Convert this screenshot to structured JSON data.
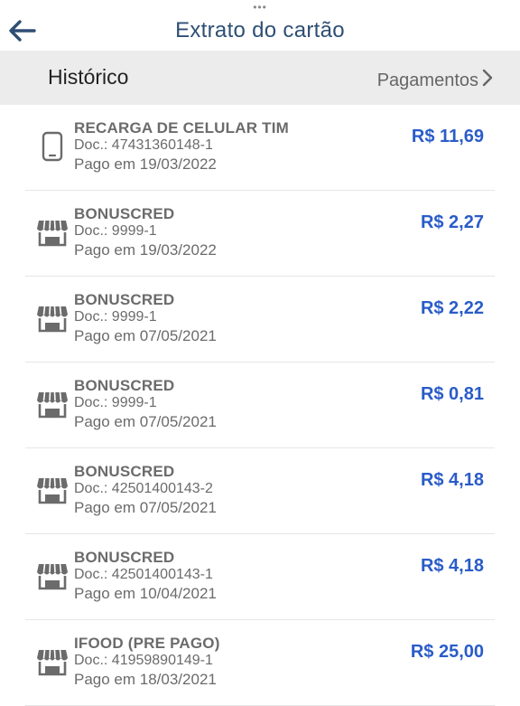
{
  "header": {
    "grabber": "•••",
    "title": "Extrato do cartão",
    "back_icon": "arrow-left-icon",
    "accent_color": "#2e4f73"
  },
  "subbar": {
    "left_label": "Histórico",
    "right_label": "Pagamentos",
    "right_icon": "chevron-right-icon"
  },
  "transactions": [
    {
      "icon": "phone-icon",
      "name": "RECARGA DE CELULAR TIM",
      "doc": "Doc.: 47431360148-1",
      "date": "Pago em 19/03/2022",
      "amount": "R$ 11,69"
    },
    {
      "icon": "store-icon",
      "name": "BONUSCRED",
      "doc": "Doc.: 9999-1",
      "date": "Pago em 19/03/2022",
      "amount": "R$ 2,27"
    },
    {
      "icon": "store-icon",
      "name": "BONUSCRED",
      "doc": "Doc.: 9999-1",
      "date": "Pago em 07/05/2021",
      "amount": "R$ 2,22"
    },
    {
      "icon": "store-icon",
      "name": "BONUSCRED",
      "doc": "Doc.: 9999-1",
      "date": "Pago em 07/05/2021",
      "amount": "R$ 0,81"
    },
    {
      "icon": "store-icon",
      "name": "BONUSCRED",
      "doc": "Doc.: 42501400143-2",
      "date": "Pago em 07/05/2021",
      "amount": "R$ 4,18"
    },
    {
      "icon": "store-icon",
      "name": "BONUSCRED",
      "doc": "Doc.: 42501400143-1",
      "date": "Pago em 10/04/2021",
      "amount": "R$ 4,18"
    },
    {
      "icon": "store-icon",
      "name": "IFOOD (PRE PAGO)",
      "doc": "Doc.: 41959890149-1",
      "date": "Pago em 18/03/2021",
      "amount": "R$ 25,00"
    }
  ]
}
